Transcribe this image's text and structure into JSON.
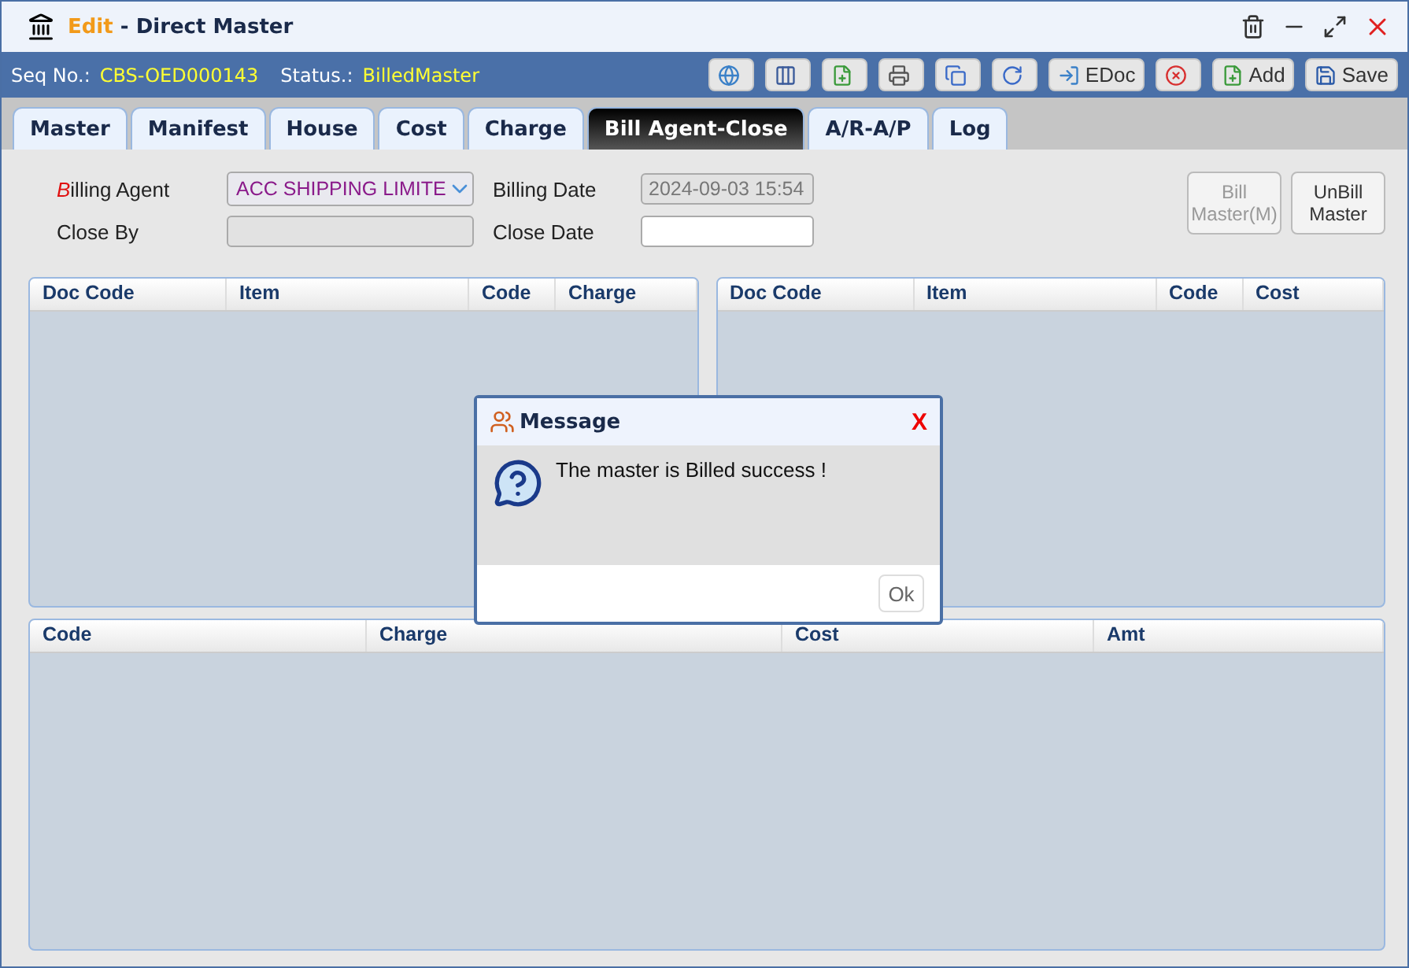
{
  "window": {
    "mode": "Edit",
    "separator": "-",
    "title": "Direct Master"
  },
  "info": [
    {
      "label": "Seq No.:",
      "value": "CBS-OED000143"
    },
    {
      "label": "Status.:",
      "value": "BilledMaster"
    }
  ],
  "toolbar": [
    {
      "kind": "globe"
    },
    {
      "kind": "columns"
    },
    {
      "kind": "new"
    },
    {
      "kind": "print"
    },
    {
      "kind": "copy"
    },
    {
      "kind": "refresh"
    },
    {
      "kind": "edoc",
      "label": "EDoc"
    },
    {
      "kind": "delete"
    },
    {
      "kind": "add",
      "label": "Add"
    },
    {
      "kind": "save",
      "label": "Save"
    }
  ],
  "tabs": [
    {
      "label": "Master",
      "selected": false
    },
    {
      "label": "Manifest",
      "selected": false
    },
    {
      "label": "House",
      "selected": false
    },
    {
      "label": "Cost",
      "selected": false
    },
    {
      "label": "Charge",
      "selected": false
    },
    {
      "label": "Bill Agent-Close",
      "selected": true
    },
    {
      "label": "A/R-A/P",
      "selected": false
    },
    {
      "label": "Log",
      "selected": false
    }
  ],
  "form": {
    "billing_agent": {
      "label": "Billing Agent",
      "required": true,
      "value": "ACC SHIPPING LIMITE"
    },
    "close_by": {
      "label": "Close By",
      "disabled": true
    },
    "billing_date": {
      "label": "Billing Date",
      "value": "2024-09-03 15:54",
      "disabled": true
    },
    "close_date": {
      "label": "Close Date",
      "disabled": false
    }
  },
  "actions": [
    {
      "label": "Bill Master(M)",
      "disabled": true
    },
    {
      "label": "UnBill Master",
      "disabled": false
    }
  ],
  "charge_grid": {
    "columns": [
      "Doc Code",
      "Item",
      "Code",
      "Charge"
    ]
  },
  "cost_grid": {
    "columns": [
      "Doc Code",
      "Item",
      "Code",
      "Cost"
    ]
  },
  "summary_grid": {
    "columns": [
      "Code",
      "Charge",
      "Cost",
      "Amt"
    ]
  },
  "dialog": {
    "title": "Message",
    "close": "X",
    "message": "The master is Billed success !",
    "button": "Ok"
  }
}
